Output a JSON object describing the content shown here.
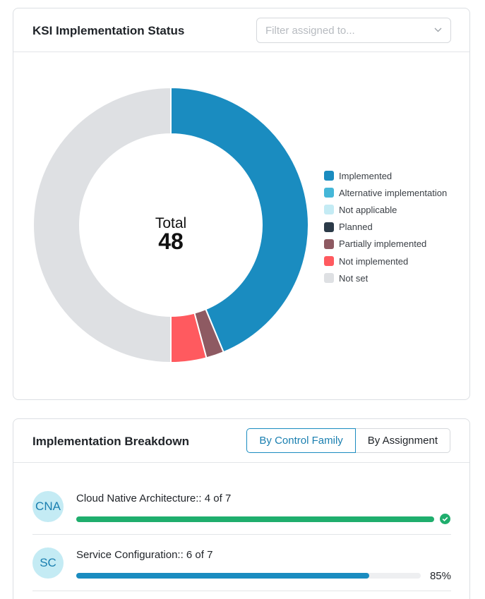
{
  "status_card": {
    "title": "KSI Implementation Status",
    "filter_placeholder": "Filter assigned to...",
    "total_label": "Total",
    "total_value": "48"
  },
  "chart_data": {
    "type": "pie",
    "variant": "donut",
    "total": 48,
    "legend_position": "right",
    "series": [
      {
        "name": "Implemented",
        "value": 21,
        "color": "#1a8cc0"
      },
      {
        "name": "Alternative implementation",
        "value": 0,
        "color": "#45b7d8"
      },
      {
        "name": "Not applicable",
        "value": 0,
        "color": "#c4ebf4"
      },
      {
        "name": "Planned",
        "value": 0,
        "color": "#2b3a48"
      },
      {
        "name": "Partially implemented",
        "value": 1,
        "color": "#8e5a62"
      },
      {
        "name": "Not implemented",
        "value": 2,
        "color": "#ff5a5f"
      },
      {
        "name": "Not set",
        "value": 24,
        "color": "#dee0e3"
      }
    ]
  },
  "breakdown_card": {
    "title": "Implementation Breakdown",
    "tabs": [
      {
        "label": "By Control Family",
        "active": true
      },
      {
        "label": "By Assignment",
        "active": false
      }
    ],
    "rows": [
      {
        "abbr": "CNA",
        "title": "Cloud Native Architecture:: 4 of 7",
        "progress": 1.0,
        "bar_color": "#1fae6d",
        "complete": true,
        "pct_label": ""
      },
      {
        "abbr": "SC",
        "title": "Service Configuration:: 6 of 7",
        "progress": 0.85,
        "bar_color": "#1a8cc0",
        "complete": false,
        "pct_label": "85%"
      }
    ]
  }
}
